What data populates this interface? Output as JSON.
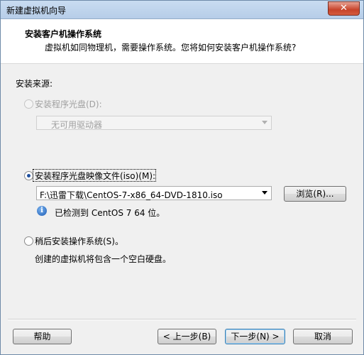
{
  "window": {
    "title": "新建虚拟机向导",
    "close_label": "✕"
  },
  "header": {
    "title": "安装客户机操作系统",
    "subtitle": "虚拟机如同物理机，需要操作系统。您将如何安装客户机操作系统?"
  },
  "source_label": "安装来源:",
  "options": {
    "disc": {
      "label": "安装程序光盘(D):",
      "drive_value": "无可用驱动器",
      "selected": false,
      "enabled": false
    },
    "iso": {
      "label": "安装程序光盘映像文件(iso)(M):",
      "path_value": "F:\\迅雷下载\\CentOS-7-x86_64-DVD-1810.iso",
      "browse_label": "浏览(R)...",
      "detected_text": "已检测到 CentOS 7 64 位。",
      "selected": true
    },
    "later": {
      "label": "稍后安装操作系统(S)。",
      "description": "创建的虚拟机将包含一个空白硬盘。",
      "selected": false
    }
  },
  "footer": {
    "help_label": "帮助",
    "back_label": "< 上一步(B)",
    "next_label": "下一步(N) >",
    "cancel_label": "取消"
  }
}
